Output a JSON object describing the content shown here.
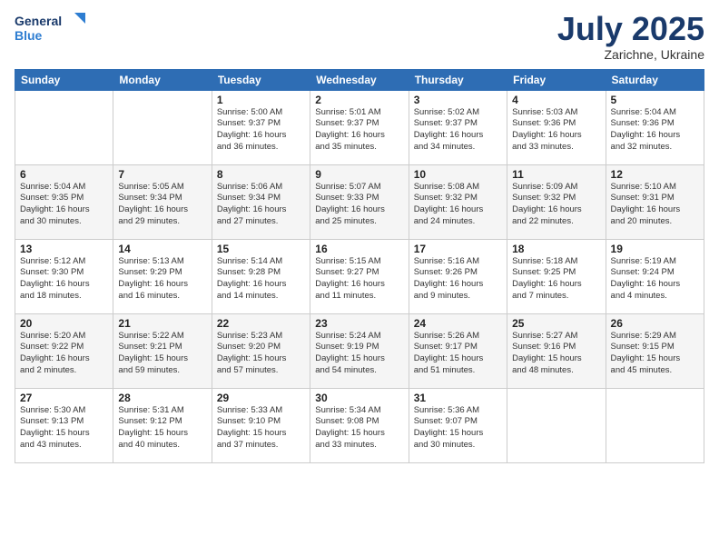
{
  "logo": {
    "line1": "General",
    "line2": "Blue"
  },
  "title": "July 2025",
  "subtitle": "Zarichne, Ukraine",
  "weekdays": [
    "Sunday",
    "Monday",
    "Tuesday",
    "Wednesday",
    "Thursday",
    "Friday",
    "Saturday"
  ],
  "weeks": [
    [
      {
        "day": "",
        "info": ""
      },
      {
        "day": "",
        "info": ""
      },
      {
        "day": "1",
        "info": "Sunrise: 5:00 AM\nSunset: 9:37 PM\nDaylight: 16 hours\nand 36 minutes."
      },
      {
        "day": "2",
        "info": "Sunrise: 5:01 AM\nSunset: 9:37 PM\nDaylight: 16 hours\nand 35 minutes."
      },
      {
        "day": "3",
        "info": "Sunrise: 5:02 AM\nSunset: 9:37 PM\nDaylight: 16 hours\nand 34 minutes."
      },
      {
        "day": "4",
        "info": "Sunrise: 5:03 AM\nSunset: 9:36 PM\nDaylight: 16 hours\nand 33 minutes."
      },
      {
        "day": "5",
        "info": "Sunrise: 5:04 AM\nSunset: 9:36 PM\nDaylight: 16 hours\nand 32 minutes."
      }
    ],
    [
      {
        "day": "6",
        "info": "Sunrise: 5:04 AM\nSunset: 9:35 PM\nDaylight: 16 hours\nand 30 minutes."
      },
      {
        "day": "7",
        "info": "Sunrise: 5:05 AM\nSunset: 9:34 PM\nDaylight: 16 hours\nand 29 minutes."
      },
      {
        "day": "8",
        "info": "Sunrise: 5:06 AM\nSunset: 9:34 PM\nDaylight: 16 hours\nand 27 minutes."
      },
      {
        "day": "9",
        "info": "Sunrise: 5:07 AM\nSunset: 9:33 PM\nDaylight: 16 hours\nand 25 minutes."
      },
      {
        "day": "10",
        "info": "Sunrise: 5:08 AM\nSunset: 9:32 PM\nDaylight: 16 hours\nand 24 minutes."
      },
      {
        "day": "11",
        "info": "Sunrise: 5:09 AM\nSunset: 9:32 PM\nDaylight: 16 hours\nand 22 minutes."
      },
      {
        "day": "12",
        "info": "Sunrise: 5:10 AM\nSunset: 9:31 PM\nDaylight: 16 hours\nand 20 minutes."
      }
    ],
    [
      {
        "day": "13",
        "info": "Sunrise: 5:12 AM\nSunset: 9:30 PM\nDaylight: 16 hours\nand 18 minutes."
      },
      {
        "day": "14",
        "info": "Sunrise: 5:13 AM\nSunset: 9:29 PM\nDaylight: 16 hours\nand 16 minutes."
      },
      {
        "day": "15",
        "info": "Sunrise: 5:14 AM\nSunset: 9:28 PM\nDaylight: 16 hours\nand 14 minutes."
      },
      {
        "day": "16",
        "info": "Sunrise: 5:15 AM\nSunset: 9:27 PM\nDaylight: 16 hours\nand 11 minutes."
      },
      {
        "day": "17",
        "info": "Sunrise: 5:16 AM\nSunset: 9:26 PM\nDaylight: 16 hours\nand 9 minutes."
      },
      {
        "day": "18",
        "info": "Sunrise: 5:18 AM\nSunset: 9:25 PM\nDaylight: 16 hours\nand 7 minutes."
      },
      {
        "day": "19",
        "info": "Sunrise: 5:19 AM\nSunset: 9:24 PM\nDaylight: 16 hours\nand 4 minutes."
      }
    ],
    [
      {
        "day": "20",
        "info": "Sunrise: 5:20 AM\nSunset: 9:22 PM\nDaylight: 16 hours\nand 2 minutes."
      },
      {
        "day": "21",
        "info": "Sunrise: 5:22 AM\nSunset: 9:21 PM\nDaylight: 15 hours\nand 59 minutes."
      },
      {
        "day": "22",
        "info": "Sunrise: 5:23 AM\nSunset: 9:20 PM\nDaylight: 15 hours\nand 57 minutes."
      },
      {
        "day": "23",
        "info": "Sunrise: 5:24 AM\nSunset: 9:19 PM\nDaylight: 15 hours\nand 54 minutes."
      },
      {
        "day": "24",
        "info": "Sunrise: 5:26 AM\nSunset: 9:17 PM\nDaylight: 15 hours\nand 51 minutes."
      },
      {
        "day": "25",
        "info": "Sunrise: 5:27 AM\nSunset: 9:16 PM\nDaylight: 15 hours\nand 48 minutes."
      },
      {
        "day": "26",
        "info": "Sunrise: 5:29 AM\nSunset: 9:15 PM\nDaylight: 15 hours\nand 45 minutes."
      }
    ],
    [
      {
        "day": "27",
        "info": "Sunrise: 5:30 AM\nSunset: 9:13 PM\nDaylight: 15 hours\nand 43 minutes."
      },
      {
        "day": "28",
        "info": "Sunrise: 5:31 AM\nSunset: 9:12 PM\nDaylight: 15 hours\nand 40 minutes."
      },
      {
        "day": "29",
        "info": "Sunrise: 5:33 AM\nSunset: 9:10 PM\nDaylight: 15 hours\nand 37 minutes."
      },
      {
        "day": "30",
        "info": "Sunrise: 5:34 AM\nSunset: 9:08 PM\nDaylight: 15 hours\nand 33 minutes."
      },
      {
        "day": "31",
        "info": "Sunrise: 5:36 AM\nSunset: 9:07 PM\nDaylight: 15 hours\nand 30 minutes."
      },
      {
        "day": "",
        "info": ""
      },
      {
        "day": "",
        "info": ""
      }
    ]
  ]
}
